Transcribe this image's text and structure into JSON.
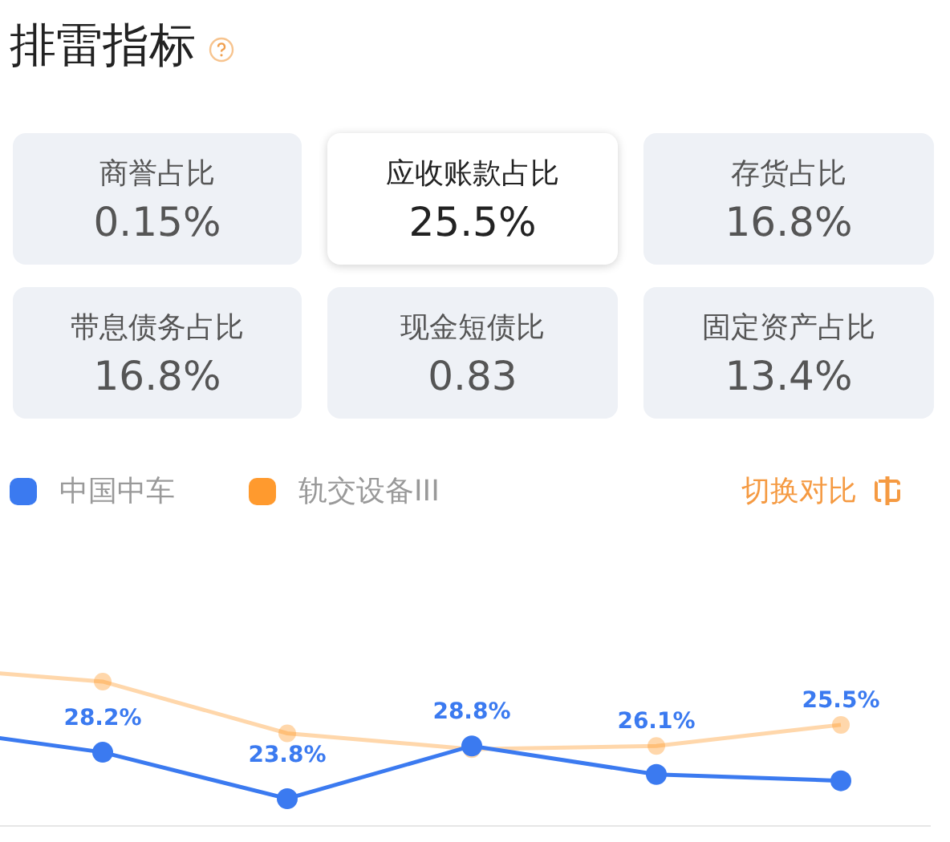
{
  "title": "排雷指标",
  "metrics": [
    {
      "label": "商誉占比",
      "value": "0.15%",
      "selected": false
    },
    {
      "label": "应收账款占比",
      "value": "25.5%",
      "selected": true
    },
    {
      "label": "存货占比",
      "value": "16.8%",
      "selected": false
    },
    {
      "label": "带息债务占比",
      "value": "16.8%",
      "selected": false
    },
    {
      "label": "现金短债比",
      "value": "0.83",
      "selected": false
    },
    {
      "label": "固定资产占比",
      "value": "13.4%",
      "selected": false
    }
  ],
  "compare_button": {
    "label": "切换对比"
  },
  "legend": [
    {
      "name": "中国中车",
      "color": "#3b7af0"
    },
    {
      "name": "轨交设备III",
      "color": "#ff9a2e"
    }
  ],
  "chart": {
    "point_labels": [
      "28.2%",
      "23.8%",
      "28.8%",
      "26.1%",
      "25.5%"
    ]
  }
}
